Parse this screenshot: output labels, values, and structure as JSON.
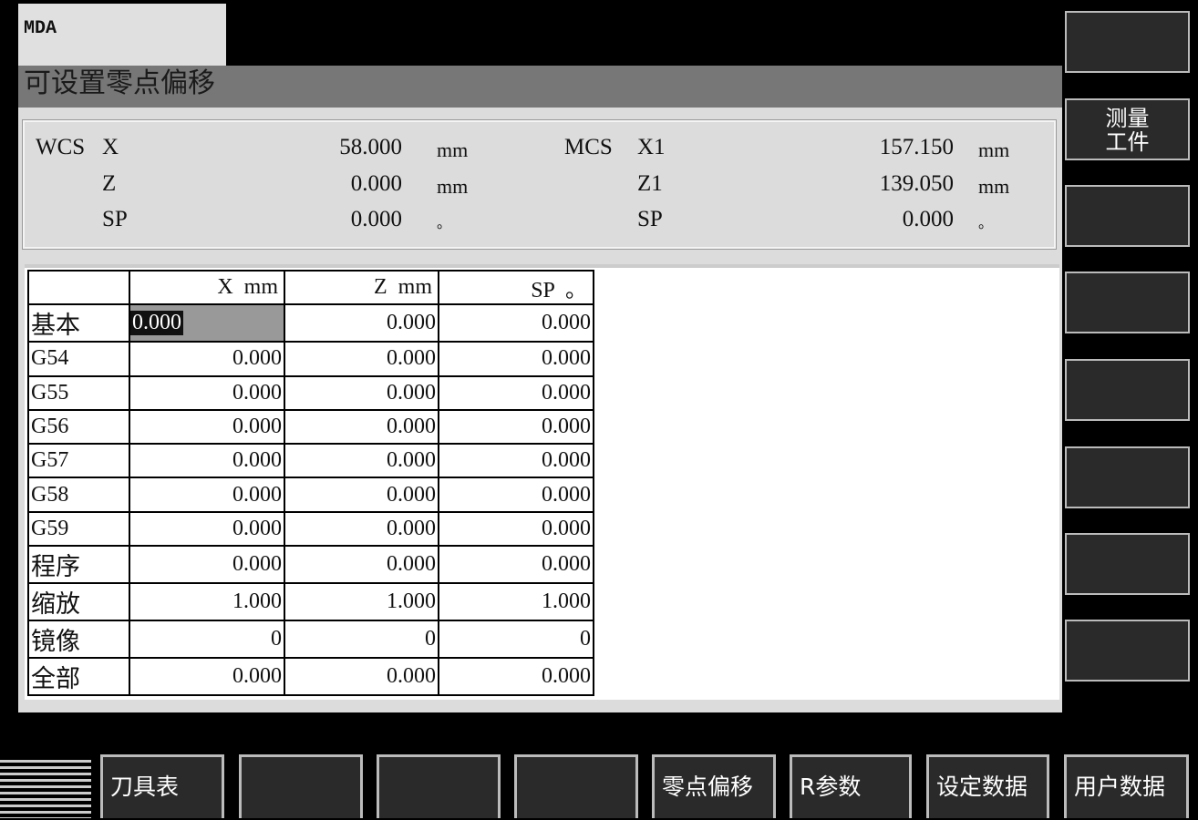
{
  "mode": "MDA",
  "title": "可设置零点偏移",
  "wcs": {
    "label": "WCS",
    "rows": [
      {
        "axis": "X",
        "value": "58.000",
        "unit": "mm"
      },
      {
        "axis": "Z",
        "value": "0.000",
        "unit": "mm"
      },
      {
        "axis": "SP",
        "value": "0.000",
        "unit": "。"
      }
    ]
  },
  "mcs": {
    "label": "MCS",
    "rows": [
      {
        "axis": "X1",
        "value": "157.150",
        "unit": "mm"
      },
      {
        "axis": "Z1",
        "value": "139.050",
        "unit": "mm"
      },
      {
        "axis": "SP",
        "value": "0.000",
        "unit": "。"
      }
    ]
  },
  "table": {
    "headers": [
      "",
      "X  mm",
      "Z  mm",
      "SP  。"
    ],
    "rows": [
      [
        "基本",
        "0.000",
        "0.000",
        "0.000"
      ],
      [
        "G54",
        "0.000",
        "0.000",
        "0.000"
      ],
      [
        "G55",
        "0.000",
        "0.000",
        "0.000"
      ],
      [
        "G56",
        "0.000",
        "0.000",
        "0.000"
      ],
      [
        "G57",
        "0.000",
        "0.000",
        "0.000"
      ],
      [
        "G58",
        "0.000",
        "0.000",
        "0.000"
      ],
      [
        "G59",
        "0.000",
        "0.000",
        "0.000"
      ],
      [
        "程序",
        "0.000",
        "0.000",
        "0.000"
      ],
      [
        "缩放",
        "1.000",
        "1.000",
        "1.000"
      ],
      [
        "镜像",
        "0",
        "0",
        "0"
      ],
      [
        "全部",
        "0.000",
        "0.000",
        "0.000"
      ]
    ]
  },
  "right_softkeys": [
    "",
    "测量\n工件",
    "",
    "",
    "",
    "",
    "",
    ""
  ],
  "bottom_softkeys": [
    "刀具表",
    "",
    "",
    "",
    "零点偏移",
    "R参数",
    "设定数据",
    "用户数据"
  ]
}
